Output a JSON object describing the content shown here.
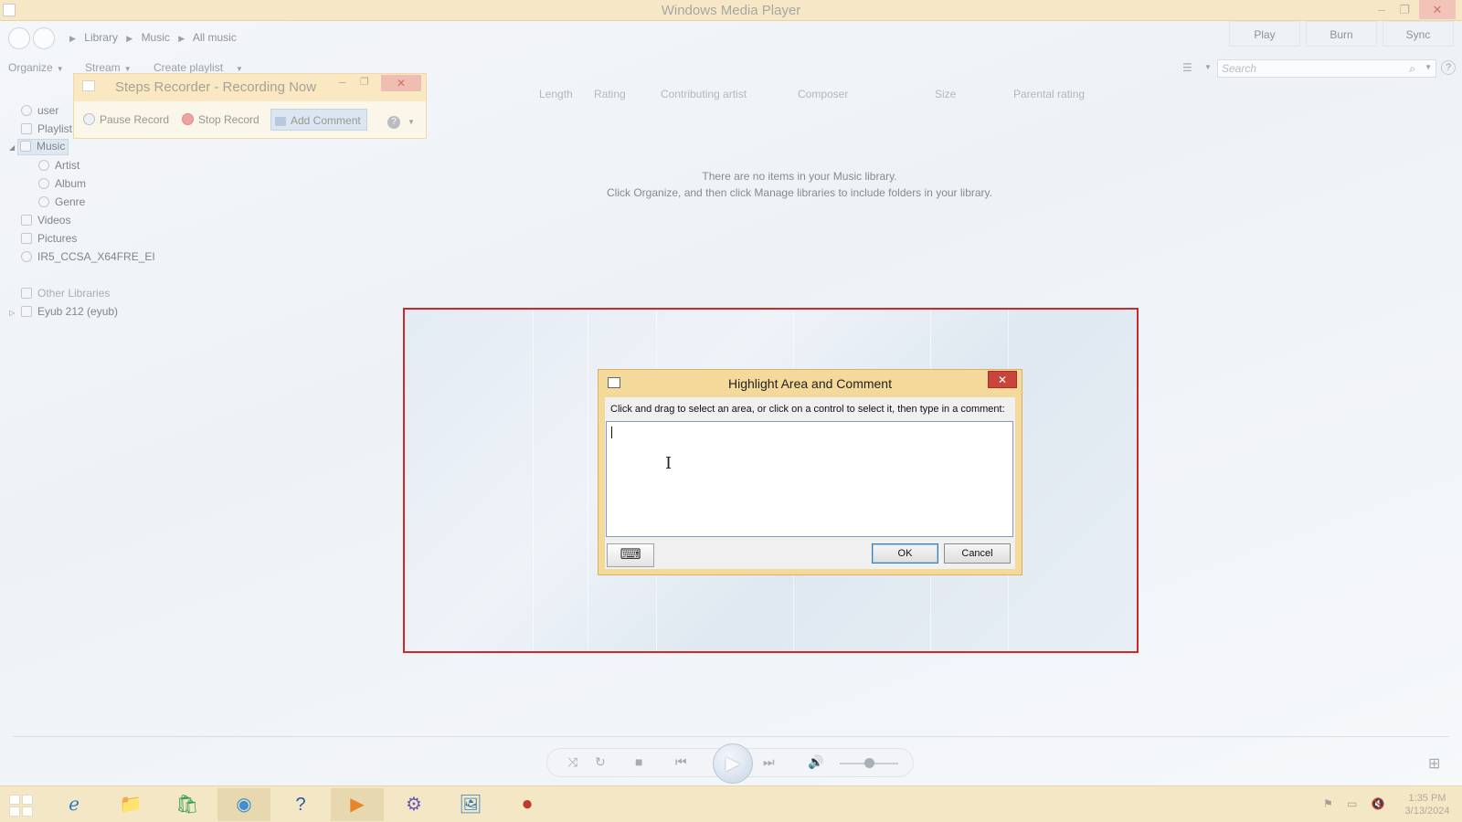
{
  "window": {
    "title": "Windows Media Player",
    "min": "–",
    "max": "❐",
    "close": "✕"
  },
  "address": {
    "crumbs": [
      "Library",
      "Music",
      "All music"
    ],
    "sep": "▶"
  },
  "top_tabs": {
    "play": "Play",
    "burn": "Burn",
    "sync": "Sync"
  },
  "toolbar": {
    "organize": "Organize",
    "stream": "Stream",
    "create_playlist": "Create playlist",
    "search_placeholder": "Search",
    "help": "?"
  },
  "columns": [
    "Length",
    "Rating",
    "Contributing artist",
    "Composer",
    "Size",
    "Parental rating"
  ],
  "nav": {
    "user": "user",
    "playlists": "Playlist",
    "music": "Music",
    "artist": "Artist",
    "album": "Album",
    "genre": "Genre",
    "videos": "Videos",
    "pictures": "Pictures",
    "disc": "IR5_CCSA_X64FRE_EI",
    "other_libraries": "Other Libraries",
    "remote": "Eyub 212 (eyub)"
  },
  "empty_message": {
    "line1": "There are no items in your Music library.",
    "line2": "Click Organize, and then click Manage libraries to include folders in your library."
  },
  "steps_recorder": {
    "title": "Steps Recorder - Recording Now",
    "pause": "Pause Record",
    "stop": "Stop Record",
    "add_comment": "Add Comment",
    "help": "?"
  },
  "highlight_dialog": {
    "title": "Highlight Area and Comment",
    "instruction": "Click and drag to select an area, or click on a control to select it, then type in a comment:",
    "comment_value": "",
    "keyboard_icon": "⌨",
    "ok": "OK",
    "cancel": "Cancel",
    "close": "✕"
  },
  "player": {
    "shuffle": "⤨",
    "repeat": "↻",
    "stop": "■",
    "prev": "⏮",
    "play": "▶",
    "next": "⏭",
    "mute": "🔊",
    "volume_level": 0.5,
    "switch_view": "⊞"
  },
  "taskbar": {
    "apps": [
      "ℯ",
      "📁",
      "🛍",
      "◉",
      "?",
      "▶",
      "⚙",
      "🖼",
      "⏺"
    ],
    "active_app": 5,
    "tray": [
      "⚑",
      "▭",
      "🔇"
    ],
    "time": "1:35 PM",
    "date": "3/13/2024"
  },
  "colors": {
    "highlight_border": "#d02828",
    "dialog_frame": "#f4d99b",
    "taskbar": "#f4e7c6"
  }
}
